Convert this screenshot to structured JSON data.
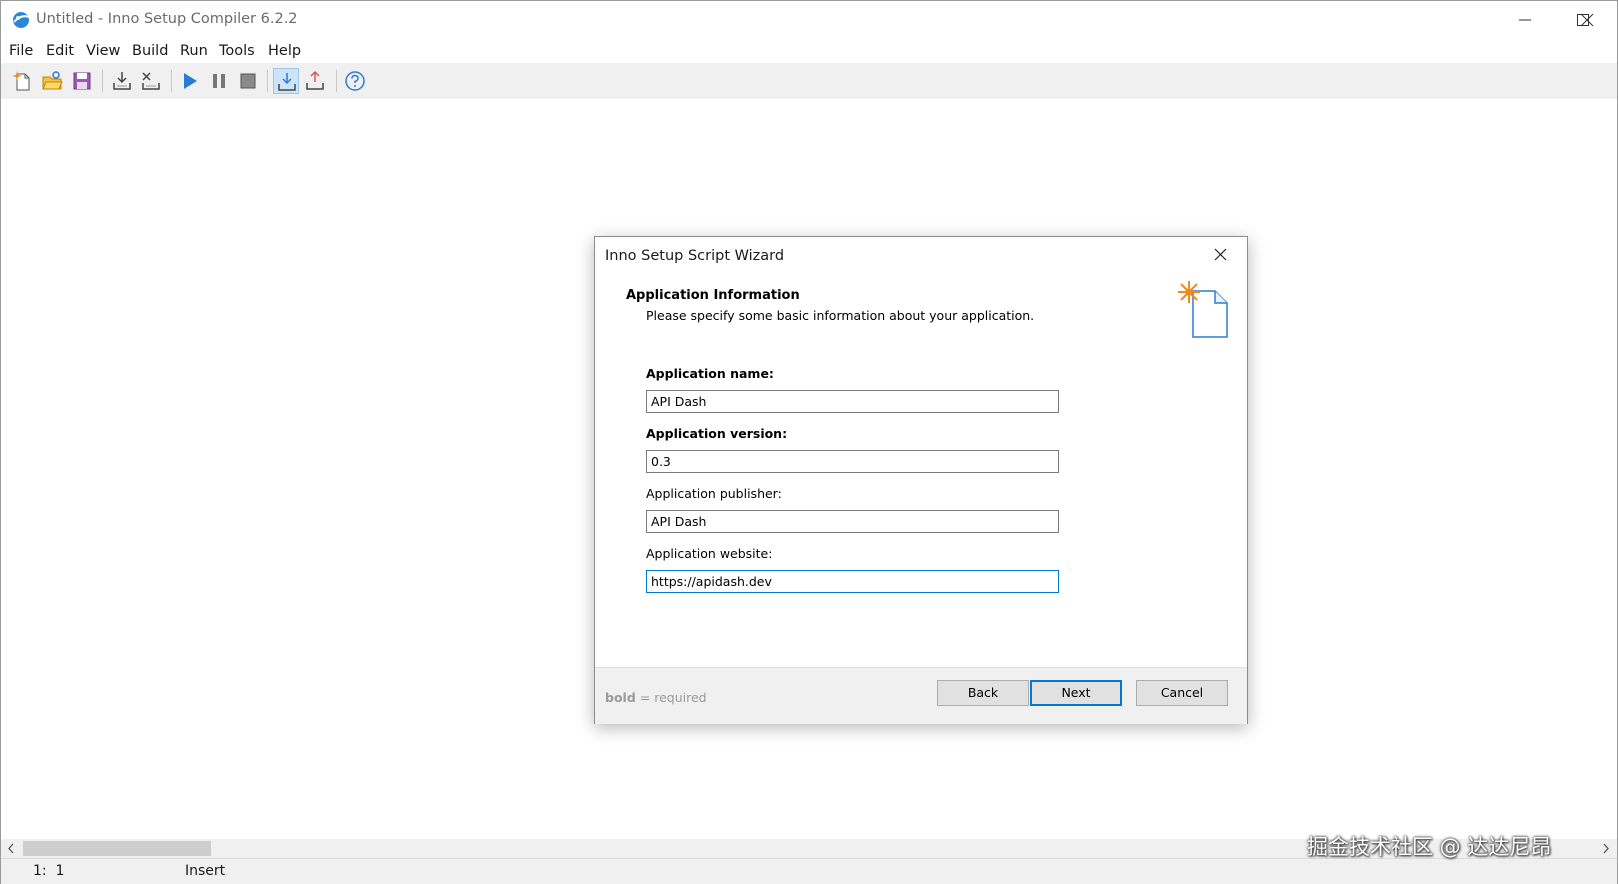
{
  "window": {
    "title": "Untitled - Inno Setup Compiler 6.2.2"
  },
  "menu": [
    "File",
    "Edit",
    "View",
    "Build",
    "Run",
    "Tools",
    "Help"
  ],
  "toolbar": {
    "buttons": [
      "new-file-icon",
      "open-folder-icon",
      "save-icon",
      "compile-icon",
      "stop-compile-icon",
      "run-icon",
      "pause-icon",
      "terminate-icon",
      "target-import-icon",
      "target-export-icon",
      "help-icon"
    ],
    "active": "target-import-icon"
  },
  "dialog": {
    "title": "Inno Setup Script Wizard",
    "section_title": "Application Information",
    "section_description": "Please specify some basic information about your application.",
    "fields": [
      {
        "label": "Application name:",
        "value": "API Dash",
        "required": true
      },
      {
        "label": "Application version:",
        "value": "0.3",
        "required": true
      },
      {
        "label": "Application publisher:",
        "value": "API Dash",
        "required": false
      },
      {
        "label": "Application website:",
        "value": "https://apidash.dev",
        "required": false,
        "focused": true
      }
    ],
    "legend": {
      "bold_word": "bold",
      "rest": " = required"
    },
    "buttons": {
      "back": "Back",
      "next": "Next",
      "cancel": "Cancel"
    }
  },
  "statusbar": {
    "position": "1:  1",
    "mode": "Insert"
  },
  "watermark": "掘金技术社区 @ 达达尼昂",
  "colors": {
    "accent": "#0078d7",
    "toolbar_bg": "#f0f0f0",
    "run_blue": "#2b7bd3",
    "wizard_star": "#f08a1c"
  }
}
